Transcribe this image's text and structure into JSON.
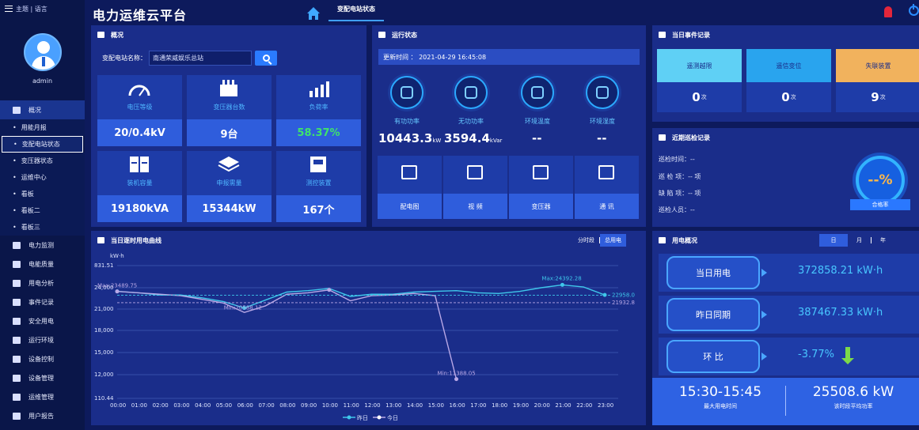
{
  "sidebar": {
    "top_label": "主题 | 语言",
    "username": "admin",
    "items": [
      {
        "label": "概况",
        "icon": "monitor-icon"
      },
      {
        "label": "电力监测",
        "icon": "gear-icon"
      },
      {
        "label": "电能质量",
        "icon": "image-icon"
      },
      {
        "label": "用电分析",
        "icon": "bar-chart-icon"
      },
      {
        "label": "事件记录",
        "icon": "document-icon"
      },
      {
        "label": "安全用电",
        "icon": "alarm-icon"
      },
      {
        "label": "运行环境",
        "icon": "thermometer-icon"
      },
      {
        "label": "设备控制",
        "icon": "control-icon"
      },
      {
        "label": "设备管理",
        "icon": "clipboard-icon"
      },
      {
        "label": "运维管理",
        "icon": "grid-icon"
      },
      {
        "label": "用户报告",
        "icon": "edit-icon"
      }
    ],
    "subitems": [
      "用能月报",
      "变配电站状态",
      "变压器状态",
      "运维中心",
      "看板",
      "看板二",
      "看板三"
    ]
  },
  "header": {
    "title": "电力运维云平台",
    "tab": "变配电站状态"
  },
  "overview": {
    "title": "概况",
    "station_label": "变配电站名称：",
    "station_value": "南通荣威娱乐总站",
    "cards": [
      {
        "label": "电压等级",
        "value": "20/0.4kV",
        "icon": "gauge-icon"
      },
      {
        "label": "变压器台数",
        "value": "9台",
        "icon": "transformer-icon"
      },
      {
        "label": "负荷率",
        "value": "58.37%",
        "icon": "load-chart-icon"
      },
      {
        "label": "装机容量",
        "value": "19180kVA",
        "icon": "cabinet-icon"
      },
      {
        "label": "申报需量",
        "value": "15344kW",
        "icon": "layers-icon"
      },
      {
        "label": "测控装置",
        "value": "167个",
        "icon": "device-icon"
      }
    ]
  },
  "runtime": {
    "title": "运行状态",
    "update_time": "更新时间 ： 2021-04-29 16:45:08",
    "metrics": [
      {
        "label": "有功功率",
        "value": "10443.3",
        "unit": "kW"
      },
      {
        "label": "无功功率",
        "value": "3594.4",
        "unit": "kVar"
      },
      {
        "label": "环境温度",
        "value": "--",
        "unit": ""
      },
      {
        "label": "环境湿度",
        "value": "--",
        "unit": ""
      }
    ],
    "buttons": [
      {
        "label": "配电图",
        "icon": "diagram-icon"
      },
      {
        "label": "视 频",
        "icon": "camera-icon"
      },
      {
        "label": "变压器",
        "icon": "battery-icon"
      },
      {
        "label": "通 讯",
        "icon": "network-icon"
      }
    ]
  },
  "events": {
    "title": "当日事件记录",
    "items": [
      {
        "label": "遥测越限",
        "count": "0",
        "unit": "次",
        "color": "#5fd0f5"
      },
      {
        "label": "遥信变位",
        "count": "0",
        "unit": "次",
        "color": "#29a4ee"
      },
      {
        "label": "失联装置",
        "count": "9",
        "unit": "次",
        "color": "#f1b25d"
      }
    ]
  },
  "inspection": {
    "title": "近期巡检记录",
    "lines": [
      "巡检时间：--",
      "巡 检 项：-- 项",
      "缺 陷 项：-- 项",
      "巡检人员：--"
    ],
    "rate": "--%",
    "rate_label": "合格率"
  },
  "curve": {
    "title": "当日逐时用电曲线",
    "toggle_a": "分时段",
    "toggle_b": "总用电",
    "legend_yesterday": "昨日",
    "legend_today": "今日",
    "colors": {
      "yesterday": "#3fc7ea",
      "today": "#b9a8e6"
    }
  },
  "chart_data": {
    "type": "line",
    "ylabel": "kW·h",
    "y_ticks": [
      "831.51",
      "24,000",
      "21,000",
      "18,000",
      "15,000",
      "12,000",
      "110.44"
    ],
    "x": [
      "00:00",
      "01:00",
      "02:00",
      "03:00",
      "04:00",
      "05:00",
      "06:00",
      "07:00",
      "08:00",
      "09:00",
      "10:00",
      "11:00",
      "12:00",
      "13:00",
      "14:00",
      "15:00",
      "16:00",
      "17:00",
      "18:00",
      "19:00",
      "20:00",
      "21:00",
      "22:00",
      "23:00"
    ],
    "series": [
      {
        "name": "昨日",
        "values": [
          23500,
          23300,
          23000,
          23000,
          22600,
          22100,
          21200,
          22300,
          23400,
          23600,
          23900,
          22800,
          23100,
          23100,
          23400,
          23500,
          23600,
          23300,
          23200,
          23500,
          24000,
          24392,
          24100,
          23000
        ]
      },
      {
        "name": "今日",
        "values": [
          23490,
          23300,
          23100,
          22900,
          22400,
          21900,
          20588,
          21500,
          23100,
          23300,
          23700,
          22200,
          22900,
          23000,
          23200,
          22900,
          11388
        ]
      }
    ],
    "annotations": [
      "Max:23489.75",
      "Min:20588.12",
      "Max:24392.28",
      "Min:11388.05",
      "22958.0",
      "21932.8"
    ]
  },
  "electricity": {
    "title": "用电概况",
    "periods": [
      "日",
      "月",
      "年"
    ],
    "rows": [
      {
        "label": "当日用电",
        "value": "372858.21 kW·h"
      },
      {
        "label": "昨日同期",
        "value": "387467.33 kW·h"
      },
      {
        "label": "环 比",
        "value": "-3.77%"
      }
    ],
    "peak_time": "15:30-15:45",
    "peak_time_label": "最大用电时间",
    "avg_power": "25508.6 kW",
    "avg_power_label": "该时段平均功率"
  }
}
